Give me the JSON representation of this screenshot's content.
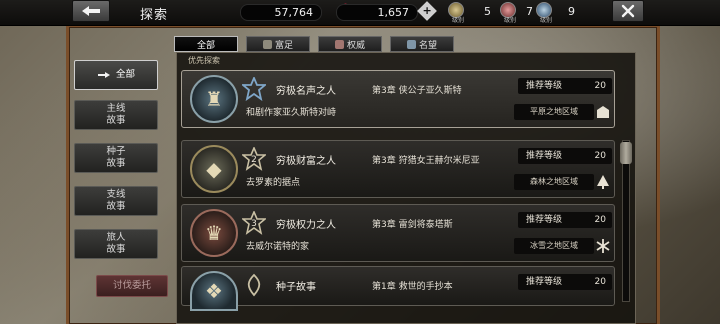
{
  "header": {
    "title": "探索",
    "resources": [
      {
        "name": "gold",
        "value": "57,764",
        "icon": "coin-icon",
        "color": "#c0874a"
      },
      {
        "name": "gem",
        "value": "1,657",
        "icon": "gem-icon",
        "color": "#c9314b"
      }
    ],
    "levels": [
      {
        "label": "级别",
        "value": "5",
        "icon": "gold-emblem-icon"
      },
      {
        "label": "级别",
        "value": "7",
        "icon": "red-emblem-icon"
      },
      {
        "label": "级别",
        "value": "9",
        "icon": "blue-emblem-icon"
      }
    ]
  },
  "filters": [
    {
      "label": "全部",
      "active": true
    },
    {
      "label": "富足",
      "active": false,
      "icon": "wealth-icon"
    },
    {
      "label": "权威",
      "active": false,
      "icon": "power-icon"
    },
    {
      "label": "名望",
      "active": false,
      "icon": "fame-icon"
    }
  ],
  "sidebar": {
    "items": [
      {
        "label": "全部",
        "active": true,
        "icon": "hand-pointer-icon"
      },
      {
        "label_line1": "主线",
        "label_line2": "故事"
      },
      {
        "label_line1": "种子",
        "label_line2": "故事"
      },
      {
        "label_line1": "支线",
        "label_line2": "故事"
      },
      {
        "label_line1": "旅人",
        "label_line2": "故事"
      }
    ],
    "bottom_button": "讨伐委托"
  },
  "section_label": "优先探索",
  "quests": [
    {
      "name": "穷极名声之人",
      "chapter": "第3章  侠公子亚久斯特",
      "subtitle": "和剧作家亚久斯特对峙",
      "rec_label": "推荐等级",
      "rec_value": "20",
      "region": "平原之地区域",
      "highlight": true,
      "emblem": "fame-emblem-icon",
      "badge_number": "",
      "accent": "#7fa6c8"
    },
    {
      "name": "穷极财富之人",
      "chapter": "第3章  狩猎女王赫尔米尼亚",
      "subtitle": "去罗素的据点",
      "rec_label": "推荐等级",
      "rec_value": "20",
      "region": "森林之地区域",
      "highlight": false,
      "emblem": "wealth-emblem-icon",
      "badge_number": "2",
      "accent": "#c9c0a4"
    },
    {
      "name": "穷极权力之人",
      "chapter": "第3章  雷剑将泰塔斯",
      "subtitle": "去威尔诺特的家",
      "rec_label": "推荐等级",
      "rec_value": "20",
      "region": "冰雪之地区域",
      "highlight": false,
      "emblem": "power-emblem-icon",
      "badge_number": "3",
      "accent": "#c9c0a4"
    },
    {
      "name": "种子故事",
      "chapter": "第1章  救世的手抄本",
      "subtitle": "",
      "rec_label": "推荐等级",
      "rec_value": "20",
      "region": "",
      "highlight": false,
      "emblem": "seed-emblem-icon",
      "badge_number": "",
      "accent": "#c9c0a4"
    }
  ]
}
